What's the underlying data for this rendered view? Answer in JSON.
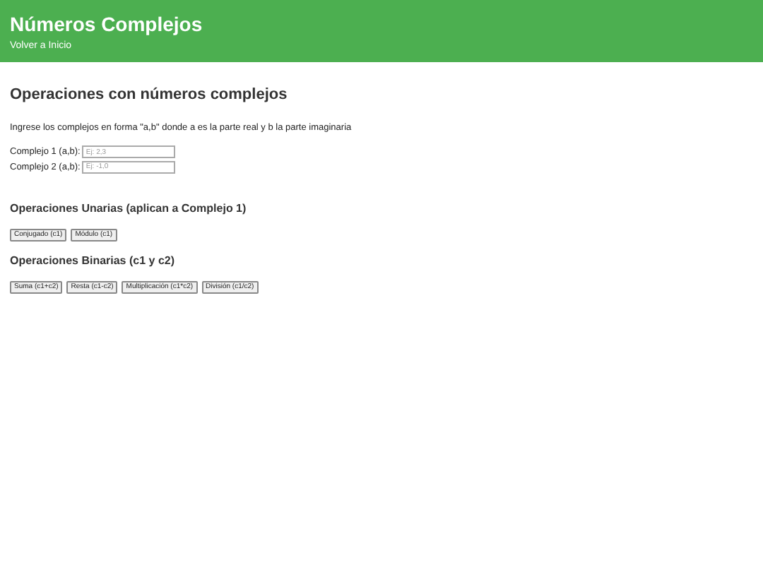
{
  "header": {
    "title": "Números Complejos",
    "link": "Volver a Inicio"
  },
  "main": {
    "title": "Operaciones con números complejos",
    "instructions": "Ingrese los complejos en forma \"a,b\" donde a es la parte real y b la parte imaginaria",
    "fields": [
      {
        "label": "Complejo 1 (a,b):",
        "placeholder": "Ej: 2,3"
      },
      {
        "label": "Complejo 2 (a,b):",
        "placeholder": "Ej: -1,0"
      }
    ],
    "sections": [
      {
        "title": "Operaciones Unarias (aplican a Complejo 1)",
        "buttons": [
          "Conjugado (c1)",
          "Módulo (c1)"
        ]
      },
      {
        "title": "Operaciones Binarias (c1 y c2)",
        "buttons": [
          "Suma (c1+c2)",
          "Resta (c1-c2)",
          "Multiplicación (c1*c2)",
          "División (c1/c2)"
        ]
      }
    ]
  }
}
